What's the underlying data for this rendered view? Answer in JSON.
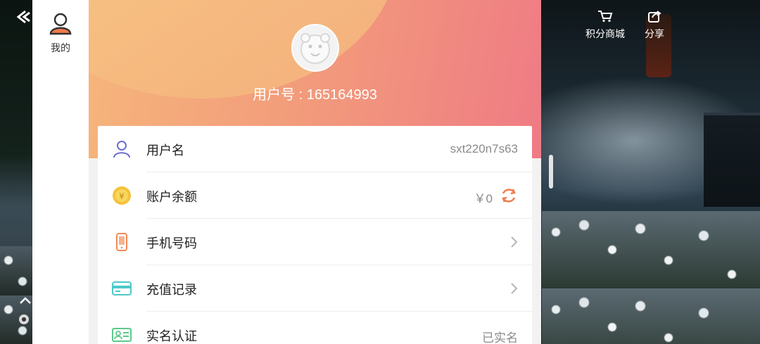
{
  "sidebar": {
    "mine_label": "我的",
    "icons": [
      "back-arrow-icon",
      "user-avatar-icon",
      "chevron-up-icon",
      "settings-icon"
    ]
  },
  "profile": {
    "user_id_text": "用户号 : 165164993",
    "avatar_icon": "tiger-avatar"
  },
  "menu": [
    {
      "label": "用户名",
      "value": "sxt220n7s63",
      "icon": "person-icon"
    },
    {
      "label": "账户余额",
      "value": "￥0",
      "icon": "coin-icon",
      "action_icon": "refresh-icon"
    },
    {
      "label": "手机号码",
      "value": "",
      "icon": "phone-icon",
      "action_icon": "chevron-right-icon"
    },
    {
      "label": "充值记录",
      "value": "",
      "icon": "card-icon",
      "action_icon": "chevron-right-icon"
    },
    {
      "label": "实名认证",
      "value": "已实名",
      "icon": "id-card-icon"
    }
  ],
  "top_actions": [
    {
      "label": "积分商城",
      "icon": "cart-icon"
    },
    {
      "label": "分享",
      "icon": "share-icon"
    }
  ],
  "colors": {
    "header_start": "#f6b67b",
    "header_end": "#ef7b85",
    "refresh_accent": "#f07a4a",
    "person_icon": "#6b6fd0",
    "coin_icon": "#f5c23a",
    "phone_icon": "#f08a5a",
    "card_icon": "#4cc9c9"
  }
}
